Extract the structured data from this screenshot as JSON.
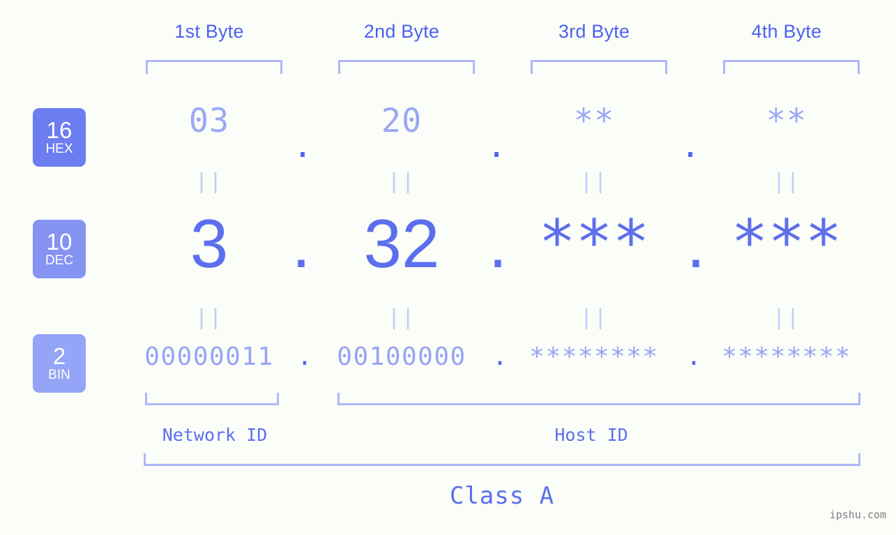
{
  "colors": {
    "background": "#fbfdf9",
    "accent_strong": "#4f64ee",
    "accent_mid": "#5b6fee",
    "accent_light": "#9aa8f5",
    "bracket": "#aeb8f7",
    "badge_hex": "#6c7df0",
    "badge_dec": "#8593f3",
    "badge_bin": "#94a4f6",
    "watermark": "#808080"
  },
  "byte_headers": [
    {
      "label": "1st Byte"
    },
    {
      "label": "2nd Byte"
    },
    {
      "label": "3rd Byte"
    },
    {
      "label": "4th Byte"
    }
  ],
  "rows": {
    "hex": {
      "badge_number": "16",
      "badge_abbr": "HEX",
      "values": [
        "03",
        "20",
        "**",
        "**"
      ],
      "separator": "."
    },
    "dec": {
      "badge_number": "10",
      "badge_abbr": "DEC",
      "values": [
        "3",
        "32",
        "***",
        "***"
      ],
      "separator": "."
    },
    "bin": {
      "badge_number": "2",
      "badge_abbr": "BIN",
      "values": [
        "00000011",
        "00100000",
        "********",
        "********"
      ],
      "separator": "."
    }
  },
  "equals_marks": {
    "glyph": "||"
  },
  "footer": {
    "network_id_label": "Network ID",
    "host_id_label": "Host ID",
    "class_label": "Class A",
    "watermark": "ipshu.com"
  }
}
